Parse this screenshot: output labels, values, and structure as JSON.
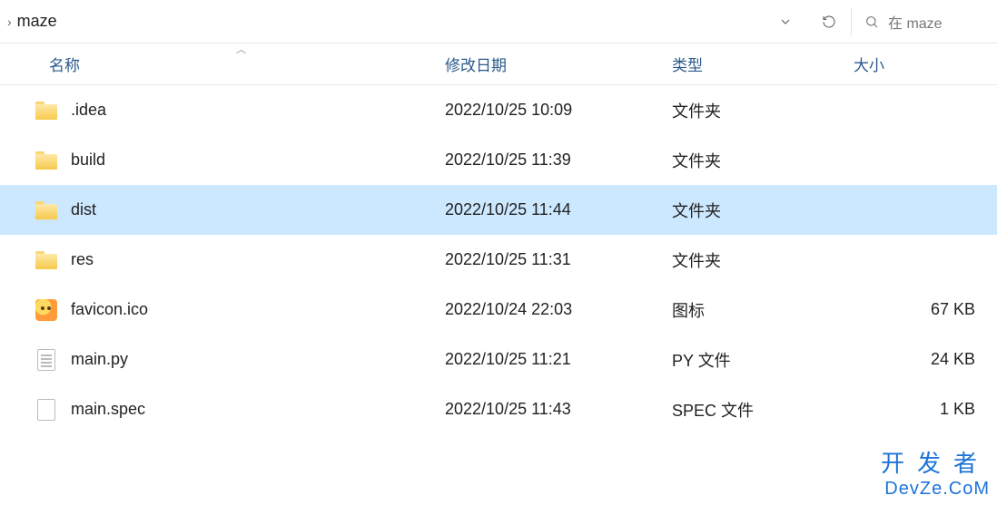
{
  "toolbar": {
    "path_segment": "maze",
    "search_placeholder": "在 maze"
  },
  "columns": {
    "name": "名称",
    "date": "修改日期",
    "type": "类型",
    "size": "大小"
  },
  "rows": [
    {
      "icon": "folder",
      "name": ".idea",
      "date": "2022/10/25 10:09",
      "type": "文件夹",
      "size": "",
      "selected": false
    },
    {
      "icon": "folder",
      "name": "build",
      "date": "2022/10/25 11:39",
      "type": "文件夹",
      "size": "",
      "selected": false
    },
    {
      "icon": "folder-open",
      "name": "dist",
      "date": "2022/10/25 11:44",
      "type": "文件夹",
      "size": "",
      "selected": true
    },
    {
      "icon": "folder",
      "name": "res",
      "date": "2022/10/25 11:31",
      "type": "文件夹",
      "size": "",
      "selected": false
    },
    {
      "icon": "ico",
      "name": "favicon.ico",
      "date": "2022/10/24 22:03",
      "type": "图标",
      "size": "67 KB",
      "selected": false
    },
    {
      "icon": "file-lines",
      "name": "main.py",
      "date": "2022/10/25 11:21",
      "type": "PY 文件",
      "size": "24 KB",
      "selected": false
    },
    {
      "icon": "file",
      "name": "main.spec",
      "date": "2022/10/25 11:43",
      "type": "SPEC 文件",
      "size": "1 KB",
      "selected": false
    }
  ],
  "watermark": {
    "line1": "开发者",
    "line2": "DevZe.CoM"
  }
}
